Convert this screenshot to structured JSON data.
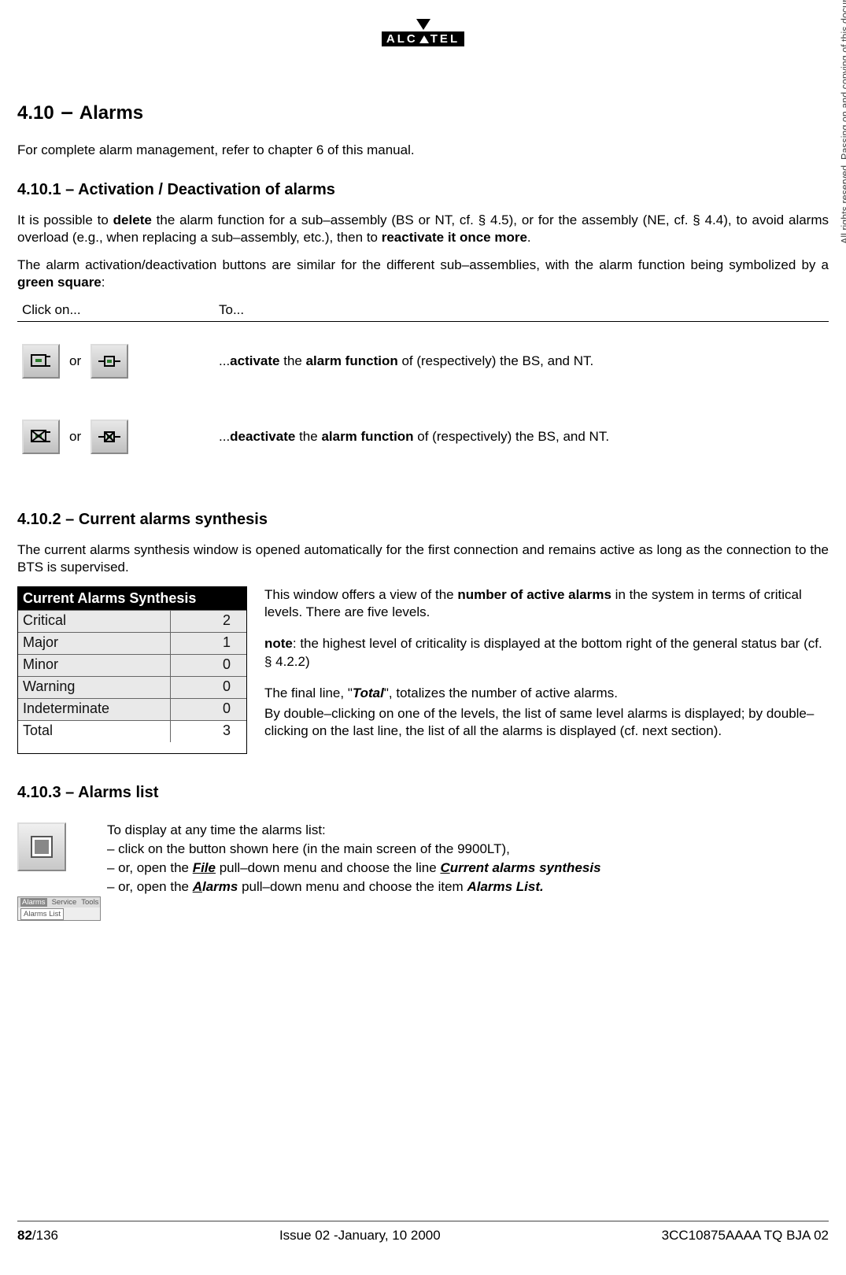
{
  "brand": "ALCATEL",
  "rights_notice": "All rights reserved. Passing on and copying of this document, use and communication of its contents not permitted without written authorization from ALCATEL",
  "section_title_num": "4.10",
  "section_title_dash": "–",
  "section_title_text": "Alarms",
  "intro": "For complete alarm management, refer to chapter 6 of this manual.",
  "sub1_title": "4.10.1 – Activation / Deactivation of alarms",
  "sub1_p1_a": "It is possible to ",
  "sub1_p1_b": "delete",
  "sub1_p1_c": " the alarm function for a sub–assembly (BS or NT, cf. § 4.5), or for the assembly (NE, cf. § 4.4), to avoid alarms overload (e.g., when replacing a sub–assembly, etc.), then to ",
  "sub1_p1_d": "reactivate it once more",
  "sub1_p1_e": ".",
  "sub1_p2_a": "The alarm activation/deactivation buttons are similar for the different sub–assemblies, with the alarm function being symbolized by a ",
  "sub1_p2_b": "green square",
  "sub1_p2_c": ":",
  "tbl_head_click": "Click on...",
  "tbl_head_to": "To...",
  "or": "or",
  "row1_a": "...",
  "row1_b": "activate",
  "row1_c": " the ",
  "row1_d": "alarm function",
  "row1_e": " of (respectively) the BS, and NT.",
  "row2_a": "...",
  "row2_b": "deactivate",
  "row2_c": " the ",
  "row2_d": "alarm function",
  "row2_e": " of (respectively) the BS, and NT.",
  "sub2_title": "4.10.2 – Current alarms synthesis",
  "sub2_p1": "The current alarms synthesis window is opened automatically for the first connection and remains active as long as the connection to the BTS is supervised.",
  "alarms_window_title": "Current Alarms Synthesis",
  "alarms_rows": [
    {
      "label": "Critical",
      "val": "2",
      "white": false
    },
    {
      "label": "Major",
      "val": "1",
      "white": false
    },
    {
      "label": "Minor",
      "val": "0",
      "white": false
    },
    {
      "label": "Warning",
      "val": "0",
      "white": false
    },
    {
      "label": "Indeterminate",
      "val": "0",
      "white": false
    },
    {
      "label": "Total",
      "val": "3",
      "white": true
    }
  ],
  "desc1_a": "This window offers a view of the ",
  "desc1_b": "number of active alarms",
  "desc1_c": " in the system in terms of critical levels. There are five levels.",
  "desc2_a": "note",
  "desc2_b": ": the highest level of criticality is displayed at the bottom right of the general status bar (cf. § 4.2.2)",
  "desc3_a": "The final line, \"",
  "desc3_b": "Total",
  "desc3_c": "\", totalizes the number of active alarms.",
  "desc4": "By double–clicking on one of the levels, the list of same level alarms is displayed; by double–clicking on the last line, the list of all the alarms is displayed (cf. next section).",
  "sub3_title": "4.10.3 – Alarms list",
  "al_line1": "To display at any time the alarms list:",
  "al_line2": "– click on the button shown here (in the main screen of the 9900LT),",
  "al_line3_a": "– or, open the ",
  "al_line3_b": "File",
  "al_line3_c": " pull–down menu and choose the line ",
  "al_line3_d": "Current alarms synthesis",
  "al_line4_a": "– or, open the ",
  "al_line4_b": "Alarms",
  "al_line4_c": " pull–down menu and choose the item ",
  "al_line4_d": "Alarms List.",
  "menu_thumb": {
    "items": [
      "Alarms",
      "Service",
      "Tools"
    ],
    "drop": "Alarms List"
  },
  "footer_page_bold": "82",
  "footer_page_rest": "/136",
  "footer_issue": "Issue 02 -January, 10 2000",
  "footer_doc": "3CC10875AAAA TQ BJA 02"
}
